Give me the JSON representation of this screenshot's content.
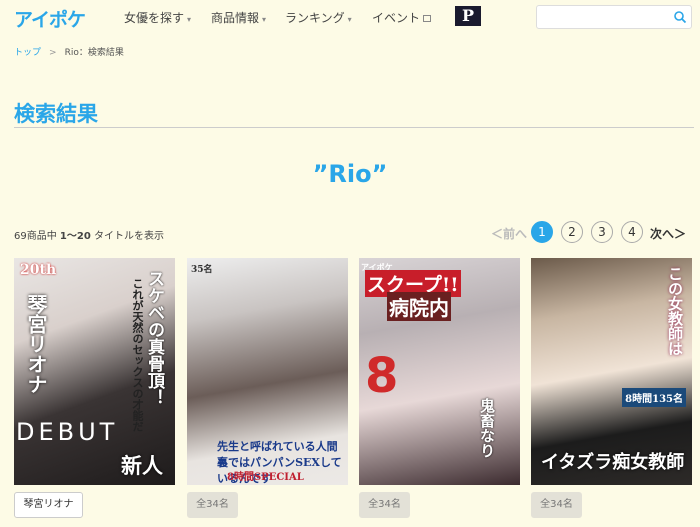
{
  "header": {
    "logo": "アイポケ",
    "nav": [
      {
        "label": "女優を探す",
        "caret": "▾"
      },
      {
        "label": "商品情報",
        "caret": "▾"
      },
      {
        "label": "ランキング",
        "caret": "▾"
      },
      {
        "label": "イベント"
      }
    ],
    "p_logo": "P",
    "search": {
      "value": "",
      "placeholder": ""
    }
  },
  "breadcrumb": {
    "home": "トップ",
    "sep": ">",
    "current": "Rio：検索結果"
  },
  "page_title": "検索結果",
  "query_display": "”Rio”",
  "results": {
    "total": "69商品中",
    "range": "1〜20",
    "suffix": "タイトルを表示"
  },
  "pagination": {
    "prev": "＜前へ",
    "pages": [
      "1",
      "2",
      "3",
      "4"
    ],
    "active": "1",
    "next": "次へ＞"
  },
  "products": [
    {
      "cover": {
        "t0": "20th",
        "t1": "スケベの真骨頂！",
        "t2": "これが天然のセックスの才能だ",
        "t3": "琴宮リオナ",
        "t4": "DEBUT",
        "t5": "新人"
      },
      "tag": "琴宮リオナ"
    },
    {
      "cover": {
        "t0": "35名",
        "t1": "先生と呼ばれている人間も",
        "t2": "裏ではパンパンSEXしているんです",
        "t3": "8時間SPECIAL"
      },
      "tag": "全34名"
    },
    {
      "cover": {
        "t0": "アイポケ",
        "t1": "スクープ!!",
        "t2": "病院内",
        "t3": "8",
        "t4": "鬼畜なり"
      },
      "tag": "全34名"
    },
    {
      "cover": {
        "t0": "この女教師は",
        "t1": "イタズラ痴女教師",
        "t2": "8時間135名"
      },
      "tag": "全34名"
    }
  ],
  "colors": {
    "accent": "#2aa6e8",
    "background": "#fdfbe6"
  }
}
